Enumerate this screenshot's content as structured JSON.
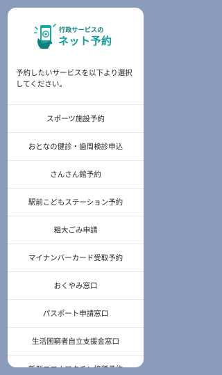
{
  "logo": {
    "subtitle": "行政サービスの",
    "title": "ネット予約"
  },
  "intro_text": "予約したいサービスを以下より選択してください。",
  "menu": [
    {
      "label": "スポーツ施設予約"
    },
    {
      "label": "おとなの健診・歯周検診申込"
    },
    {
      "label": "さんさん館予約"
    },
    {
      "label": "駅前こどもステーション予約"
    },
    {
      "label": "粗大ごみ申請"
    },
    {
      "label": "マイナンバーカード受取予約"
    },
    {
      "label": "おくやみ窓口"
    },
    {
      "label": "パスポート申請窓口"
    },
    {
      "label": "生活困窮者自立支援金窓口"
    },
    {
      "label": "新型コロナワクチン接種予約"
    }
  ],
  "colors": {
    "background": "#8b9bbc",
    "brand": "#0f9b97",
    "card": "#ffffff"
  }
}
